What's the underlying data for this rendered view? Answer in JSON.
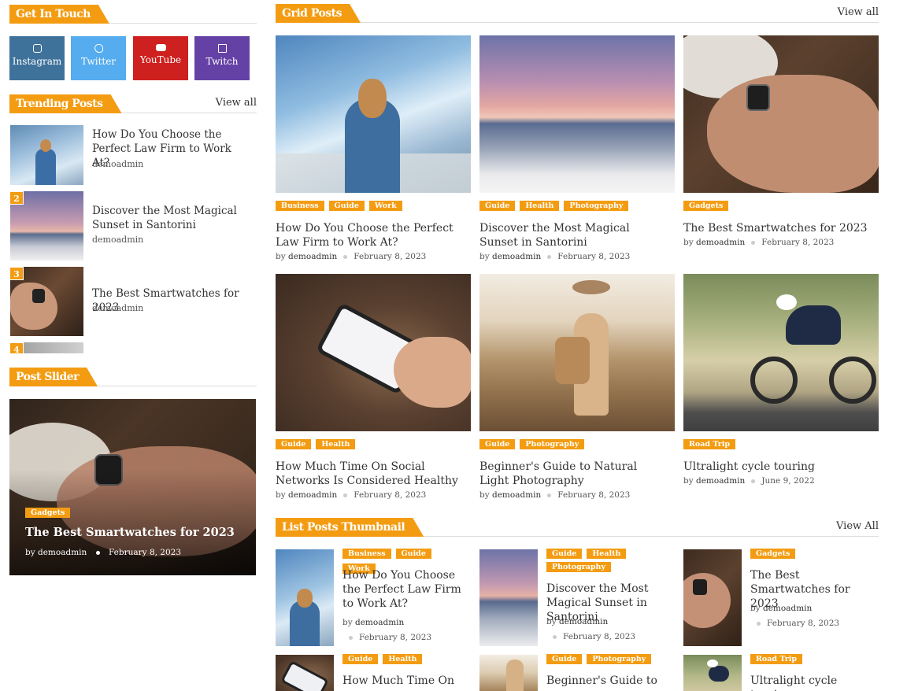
{
  "get_in_touch": {
    "title": "Get In Touch",
    "socials": [
      {
        "label": "Instagram",
        "icon": "instagram-icon",
        "color": "#3f729b"
      },
      {
        "label": "Twitter",
        "icon": "twitter-icon",
        "color": "#55acee"
      },
      {
        "label": "YouTube",
        "icon": "youtube-icon",
        "color": "#cd201f"
      },
      {
        "label": "Twitch",
        "icon": "twitch-icon",
        "color": "#6441a5"
      }
    ]
  },
  "trending": {
    "title": "Trending Posts",
    "view_all": "View all",
    "items": [
      {
        "num": "1",
        "title": "How Do You Choose the Perfect Law Firm to Work At?",
        "author": "demoadmin"
      },
      {
        "num": "2",
        "title": "Discover the Most Magical Sunset in Santorini",
        "author": "demoadmin"
      },
      {
        "num": "3",
        "title": "The Best Smartwatches for 2023",
        "author": "demoadmin"
      },
      {
        "num": "4",
        "title": "",
        "author": ""
      }
    ]
  },
  "post_slider": {
    "title": "Post Slider",
    "tag": "Gadgets",
    "post_title": "The Best Smartwatches for 2023",
    "by": "by",
    "author": "demoadmin",
    "date": "February 8, 2023"
  },
  "grid": {
    "title": "Grid Posts",
    "view_all": "View all",
    "posts": [
      {
        "tags": [
          "Business",
          "Guide",
          "Work"
        ],
        "title": "How Do You Choose the Perfect Law Firm to Work At?",
        "by": "by",
        "author": "demoadmin",
        "date": "February 8, 2023"
      },
      {
        "tags": [
          "Guide",
          "Health",
          "Photography"
        ],
        "title": "Discover the Most Magical Sunset in Santorini",
        "by": "by",
        "author": "demoadmin",
        "date": "February 8, 2023"
      },
      {
        "tags": [
          "Gadgets"
        ],
        "title": "The Best Smartwatches for 2023",
        "by": "by",
        "author": "demoadmin",
        "date": "February 8, 2023"
      },
      {
        "tags": [
          "Guide",
          "Health"
        ],
        "title": "How Much Time On Social Networks Is Considered Healthy",
        "by": "by",
        "author": "demoadmin",
        "date": "February 8, 2023"
      },
      {
        "tags": [
          "Guide",
          "Photography"
        ],
        "title": "Beginner's Guide to Natural Light Photography",
        "by": "by",
        "author": "demoadmin",
        "date": "February 8, 2023"
      },
      {
        "tags": [
          "Road Trip"
        ],
        "title": "Ultralight cycle touring",
        "by": "by",
        "author": "demoadmin",
        "date": "June 9, 2022"
      }
    ]
  },
  "list_thumb": {
    "title": "List Posts Thumbnail",
    "view_all": "View All",
    "posts": [
      {
        "tags": [
          "Business",
          "Guide",
          "Work"
        ],
        "title": "How Do You Choose the Perfect Law Firm to Work At?",
        "by": "by",
        "author": "demoadmin",
        "date": "February 8, 2023"
      },
      {
        "tags": [
          "Guide",
          "Health",
          "Photography"
        ],
        "title": "Discover the Most Magical Sunset in Santorini",
        "by": "by",
        "author": "demoadmin",
        "date": "February 8, 2023"
      },
      {
        "tags": [
          "Gadgets"
        ],
        "title": "The Best Smartwatches for 2023",
        "by": "by",
        "author": "demoadmin",
        "date": "February 8, 2023"
      },
      {
        "tags": [
          "Guide",
          "Health"
        ],
        "title": "How Much Time On",
        "by": "",
        "author": "",
        "date": ""
      },
      {
        "tags": [
          "Guide",
          "Photography"
        ],
        "title": "Beginner's Guide to",
        "by": "",
        "author": "",
        "date": ""
      },
      {
        "tags": [
          "Road Trip"
        ],
        "title": "Ultralight cycle touring",
        "by": "",
        "author": "",
        "date": ""
      }
    ]
  }
}
